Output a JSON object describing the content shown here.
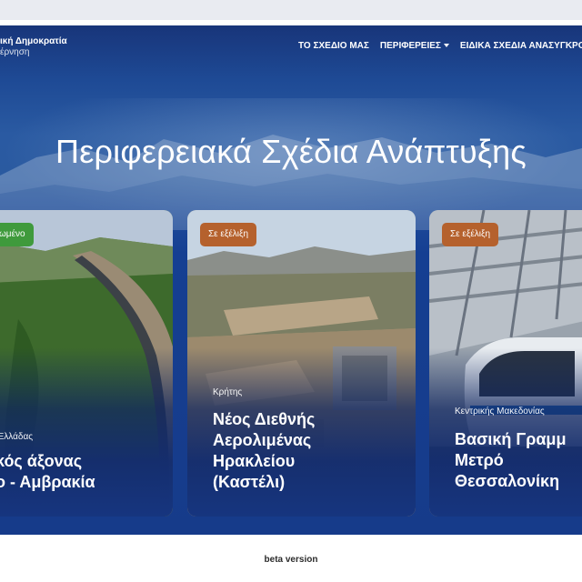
{
  "header": {
    "logo_line1": "ική Δημοκρατία",
    "logo_line2": "έρνηση",
    "nav": [
      {
        "label": "ΤΟ ΣΧΕΔΙΟ ΜΑΣ"
      },
      {
        "label": "ΠΕΡΙΦΕΡΕΙΕΣ"
      },
      {
        "label": "ΕΙΔΙΚΑ ΣΧΕΔΙΑ ΑΝΑΣΥΓΚΡΟΤΗ"
      }
    ]
  },
  "hero": {
    "title": "Περιφερειακά Σχέδια Ανάπτυξης"
  },
  "cards": [
    {
      "status": "ωμένο",
      "status_color": "#3f9a3c",
      "region": "ς Ελλάδας",
      "title_lines": [
        "ικός άξονας",
        "ιο - Αμβρακία"
      ]
    },
    {
      "status": "Σε εξέλιξη",
      "status_color": "#b5612d",
      "region": "Κρήτης",
      "title_lines": [
        "Νέος Διεθνής",
        "Αερολιμένας",
        "Ηρακλείου",
        "(Καστέλι)"
      ]
    },
    {
      "status": "Σε εξέλιξη",
      "status_color": "#b5612d",
      "region": "Κεντρικής Μακεδονίας",
      "title_lines": [
        "Βασική Γραμμ",
        "Μετρό",
        "Θεσσαλονίκη"
      ]
    }
  ],
  "footer": {
    "label": "beta version"
  }
}
